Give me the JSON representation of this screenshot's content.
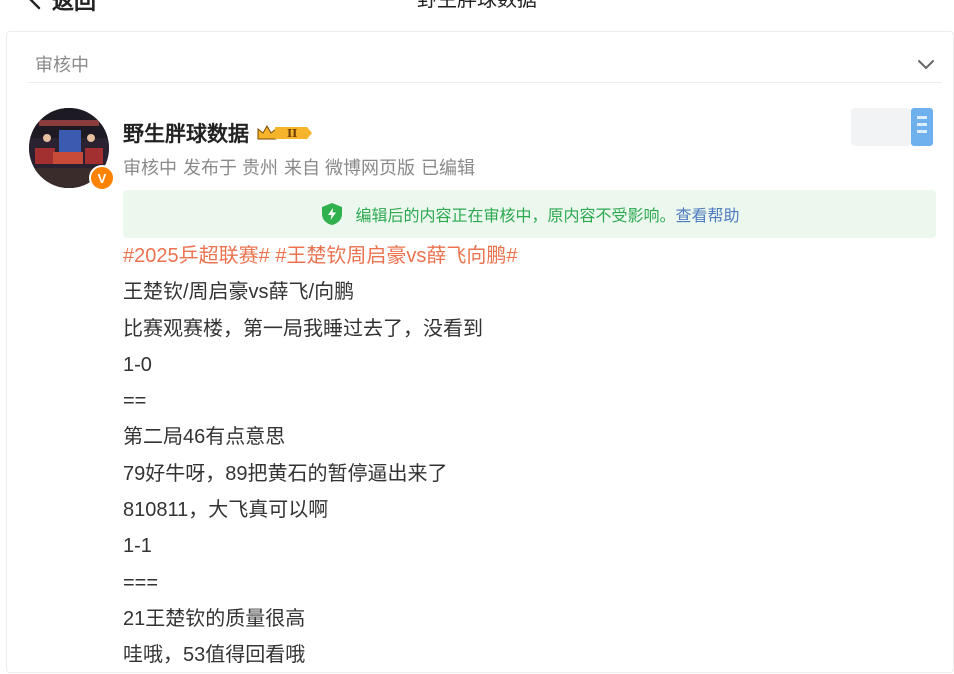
{
  "header": {
    "back_label": "返回",
    "title": "野生胖球数据"
  },
  "review": {
    "label": "审核中"
  },
  "author": {
    "name": "野生胖球数据",
    "level_badge": "II",
    "verified_badge": "V",
    "meta": {
      "status": "审核中",
      "published_in": "发布于 贵州",
      "source": "来自 微博网页版",
      "edited": "已编辑"
    }
  },
  "notice": {
    "text": "编辑后的内容正在审核中，原内容不受影响。",
    "help_link": "查看帮助"
  },
  "post": {
    "tags": [
      "#2025乒超联赛#",
      "#王楚钦周启豪vs薛飞向鹏#"
    ],
    "lines": [
      "王楚钦/周启豪vs薛飞/向鹏",
      "比赛观赛楼，第一局我睡过去了，没看到",
      "1-0",
      "==",
      "第二局46有点意思",
      "79好牛呀，89把黄石的暂停逼出来了",
      "810811，大飞真可以啊",
      "1-1",
      "===",
      "21王楚钦的质量很高",
      "哇哦，53值得回看哦"
    ]
  },
  "colors": {
    "tag": "#eb7350",
    "notice_text": "#2eaa52",
    "notice_bg": "#ecf7ee",
    "link": "#4f7cc0",
    "vip": "#ff8200"
  }
}
